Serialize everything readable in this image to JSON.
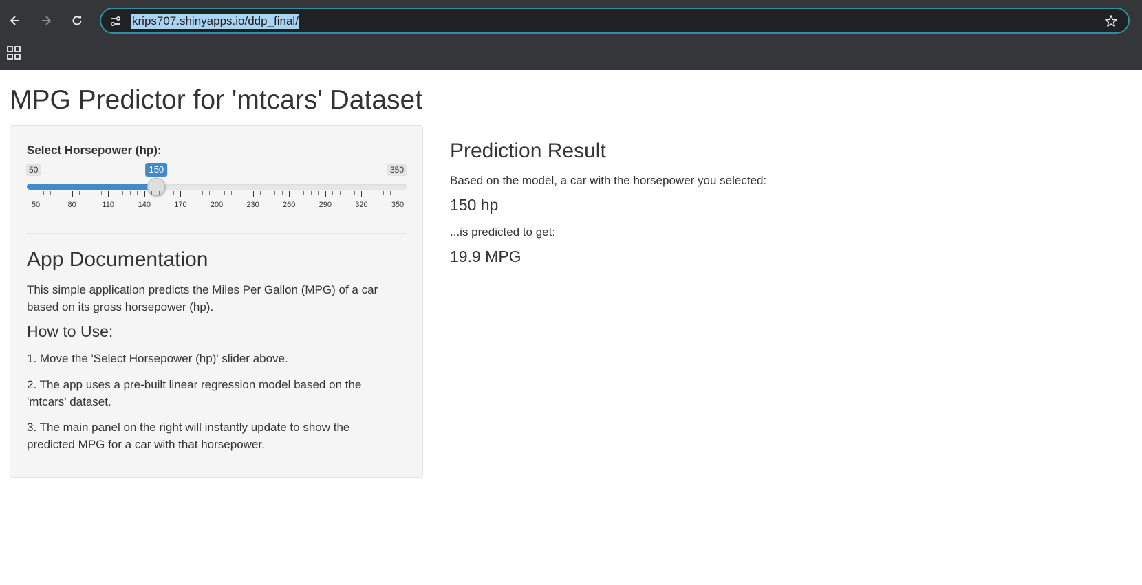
{
  "browser": {
    "url": "krips707.shinyapps.io/ddp_final/",
    "icons": [
      "back-icon",
      "forward-icon",
      "reload-icon",
      "site-info-icon",
      "bookmark-star-icon",
      "apps-grid-icon"
    ]
  },
  "page": {
    "title": "MPG Predictor for 'mtcars' Dataset"
  },
  "sidebar": {
    "slider": {
      "label": "Select Horsepower (hp):",
      "min": 50,
      "max": 350,
      "value": 150,
      "min_label": "50",
      "max_label": "350",
      "value_label": "150",
      "tick_labels": [
        "50",
        "80",
        "110",
        "140",
        "170",
        "200",
        "230",
        "260",
        "290",
        "320",
        "350"
      ],
      "accent_color": "#428bca"
    },
    "doc": {
      "title": "App Documentation",
      "intro": "This simple application predicts the Miles Per Gallon (MPG) of a car based on its gross horsepower (hp).",
      "how_title": "How to Use:",
      "steps": [
        "1. Move the 'Select Horsepower (hp)' slider above.",
        "2. The app uses a pre-built linear regression model based on the 'mtcars' dataset.",
        "3. The main panel on the right will instantly update to show the predicted MPG for a car with that horsepower."
      ]
    }
  },
  "main": {
    "title": "Prediction Result",
    "intro": "Based on the model, a car with the horsepower you selected:",
    "hp_value": "150 hp",
    "predicted_label": "...is predicted to get:",
    "mpg_value": "19.9 MPG"
  }
}
